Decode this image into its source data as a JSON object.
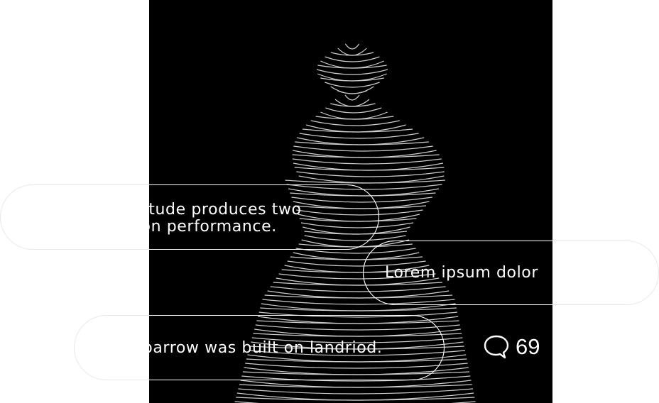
{
  "cards": [
    {
      "line1": "High altitude produces two",
      "line2": "effects on performance."
    },
    {
      "line1": "Lorem ipsum dolor"
    },
    {
      "line1": "The long barrow was built on landriod."
    }
  ],
  "comments": {
    "icon": "speech-bubble-icon",
    "count": "69"
  },
  "colors": {
    "background": "#ffffff",
    "art_background": "#000000",
    "text": "#ffffff",
    "outline": "#e8e8e8"
  }
}
